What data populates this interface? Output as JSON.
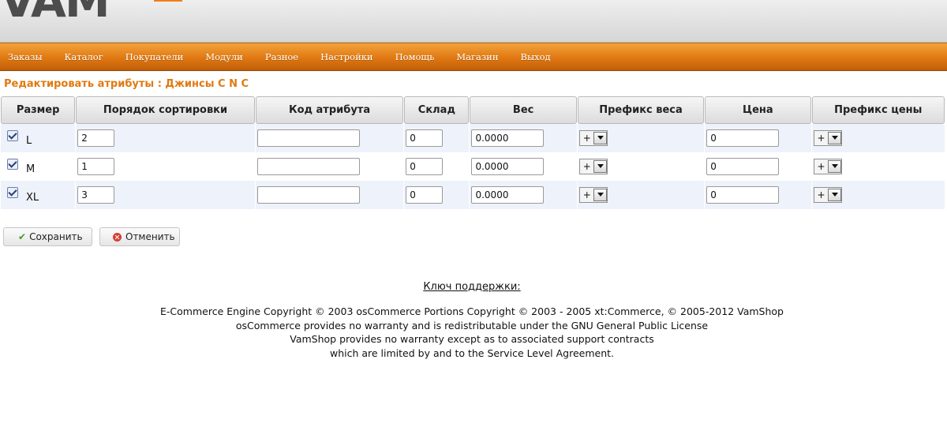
{
  "logo": {
    "text": "VAM"
  },
  "menu": {
    "items": [
      "Заказы",
      "Каталог",
      "Покупатели",
      "Модули",
      "Разное",
      "Настройки",
      "Помощь",
      "Магазин",
      "Выход"
    ]
  },
  "page_title": "Редактировать атрибуты : Джинсы C N C",
  "table": {
    "headers": [
      "Размер",
      "Порядок сортировки",
      "Код атрибута",
      "Склад",
      "Вес",
      "Префикс веса",
      "Цена",
      "Префикс цены"
    ],
    "rows": [
      {
        "checked": true,
        "size": "L",
        "sort_order": "2",
        "attr_code": "",
        "stock": "0",
        "weight": "0.0000",
        "weight_prefix": "+",
        "price": "0",
        "price_prefix": "+"
      },
      {
        "checked": true,
        "size": "M",
        "sort_order": "1",
        "attr_code": "",
        "stock": "0",
        "weight": "0.0000",
        "weight_prefix": "+",
        "price": "0",
        "price_prefix": "+"
      },
      {
        "checked": true,
        "size": "XL",
        "sort_order": "3",
        "attr_code": "",
        "stock": "0",
        "weight": "0.0000",
        "weight_prefix": "+",
        "price": "0",
        "price_prefix": "+"
      }
    ]
  },
  "buttons": {
    "save": "Сохранить",
    "cancel": "Отменить"
  },
  "support_key": "Ключ поддержки:",
  "footer": {
    "lines": [
      "E-Commerce Engine Copyright © 2003 osCommerce Portions Copyright © 2003 - 2005 xt:Commerce, © 2005-2012 VamShop",
      "osCommerce provides no warranty and is redistributable under the GNU General Public License",
      "VamShop provides no warranty except as to associated support contracts",
      "which are limited by and to the Service Level Agreement."
    ]
  }
}
